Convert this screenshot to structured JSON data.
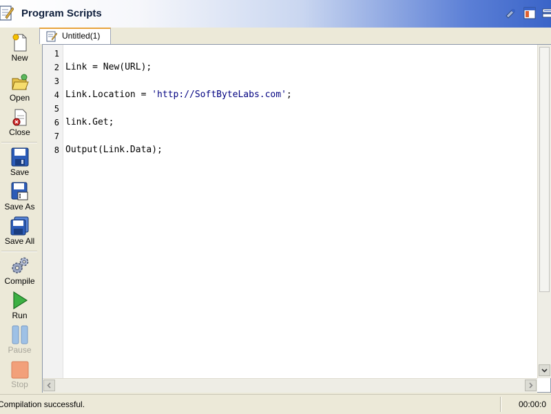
{
  "window": {
    "title": "Program Scripts"
  },
  "toolbar": {
    "new": "New",
    "open": "Open",
    "close": "Close",
    "save": "Save",
    "save_as": "Save As",
    "save_all": "Save All",
    "compile": "Compile",
    "run": "Run",
    "pause": "Pause",
    "stop": "Stop"
  },
  "tabs": [
    {
      "label": "Untitled(1)"
    }
  ],
  "editor": {
    "line_numbers": [
      "1",
      "2",
      "3",
      "4",
      "5",
      "6",
      "7",
      "8"
    ],
    "lines": {
      "l2": "Link = New(URL);",
      "l4_pre": "Link.Location = ",
      "l4_str": "'http://SoftByteLabs.com'",
      "l4_post": ";",
      "l6": "link.Get;",
      "l8": "Output(Link.Data);"
    }
  },
  "status": {
    "message": "Compilation successful.",
    "time": "00:00:0"
  },
  "colors": {
    "string_literal": "#000080",
    "active_tab_accent": "#e8a33a",
    "title_gradient_end": "#3a64c8"
  },
  "icons": {
    "title": "script-edit-icon",
    "title_bar_right": [
      "pin-icon",
      "window-layout-icon",
      "connection-icon"
    ],
    "tab": "document-edit-icon"
  }
}
